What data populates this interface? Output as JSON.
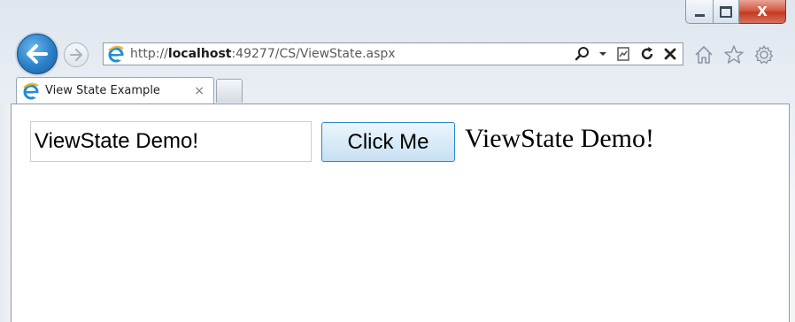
{
  "window": {
    "controls": {
      "minimize": "minimize",
      "maximize": "maximize",
      "close_glyph": "X"
    }
  },
  "nav": {
    "url_prefix": "http://",
    "url_host": "localhost",
    "url_rest": ":49277/CS/ViewState.aspx",
    "icons": [
      "back-arrow-icon",
      "forward-arrow-icon",
      "ie-logo-icon",
      "search-icon",
      "dropdown-icon",
      "compat-view-icon",
      "refresh-icon",
      "stop-icon",
      "home-icon",
      "favorites-star-icon",
      "settings-gear-icon"
    ]
  },
  "tabs": [
    {
      "title": "View State Example",
      "close_glyph": "×"
    }
  ],
  "page": {
    "input_value": "ViewState Demo!",
    "button_label": "Click Me",
    "label_text": "ViewState Demo!"
  },
  "colors": {
    "accent_blue": "#2a7fc7",
    "close_red": "#c43a22",
    "button_border": "#2d87c8"
  }
}
